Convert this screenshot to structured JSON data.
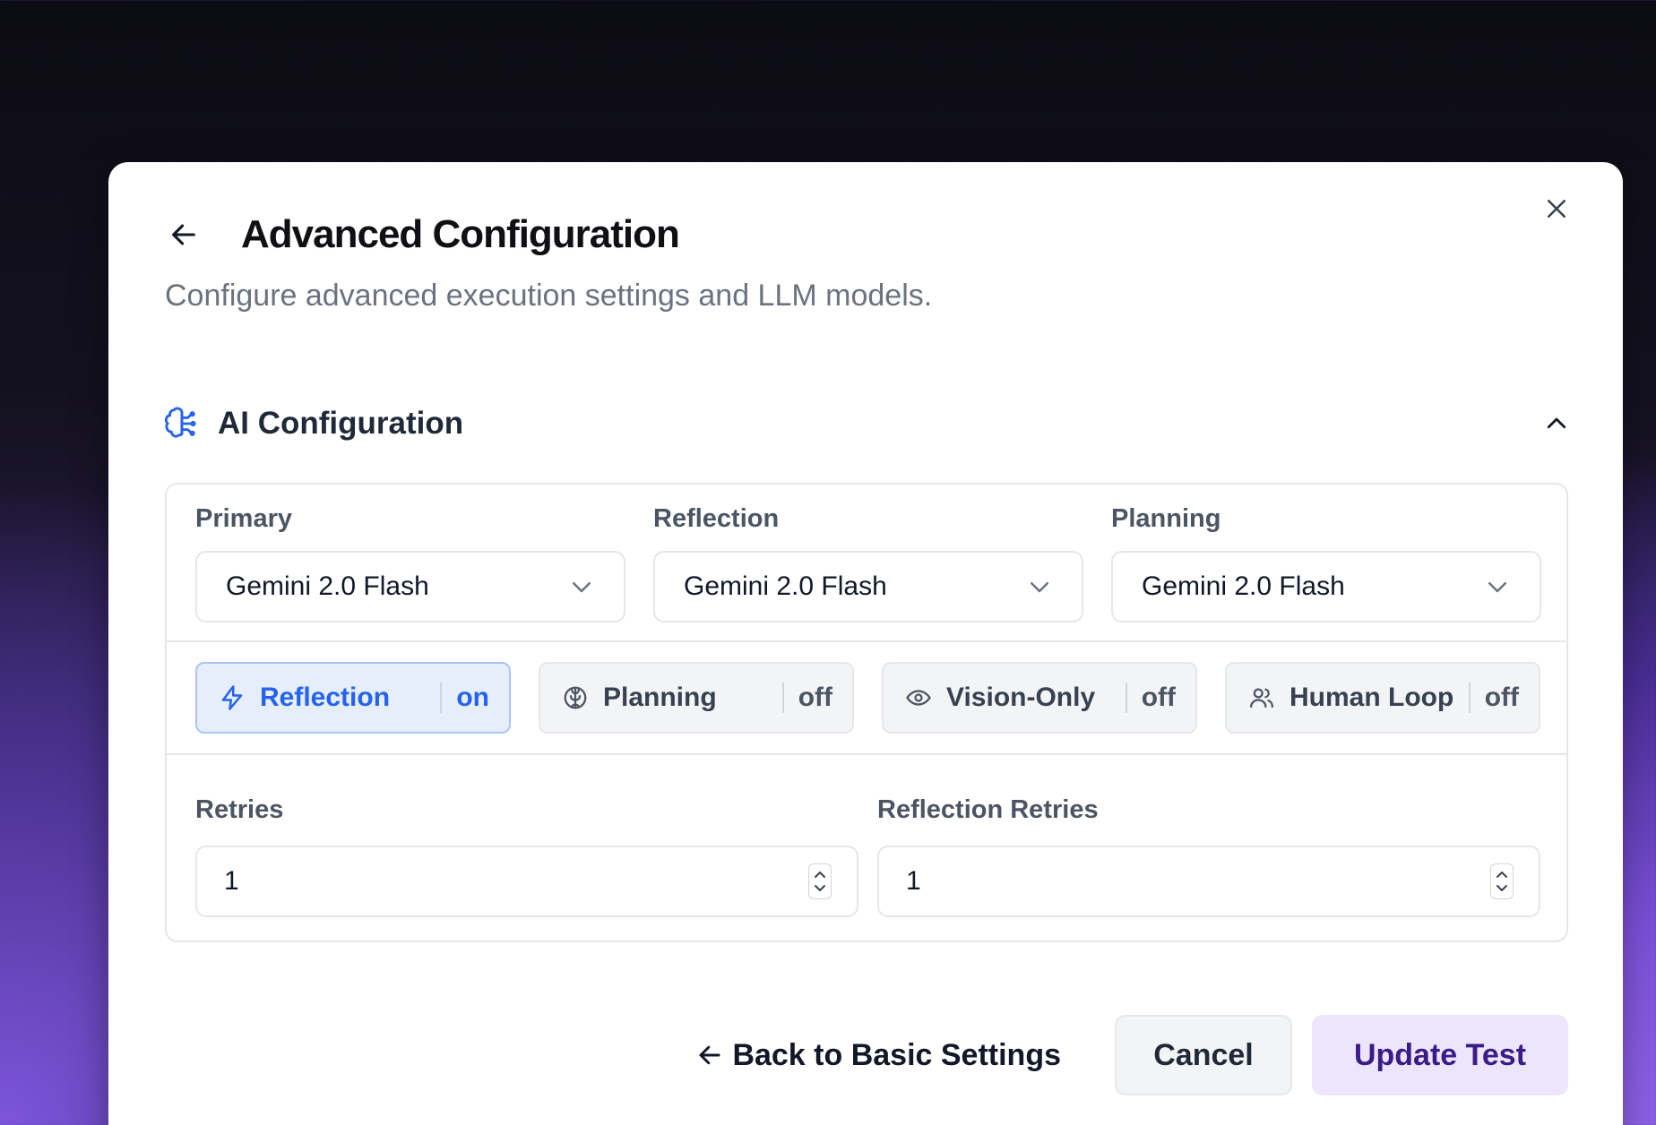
{
  "dialog": {
    "title": "Advanced Configuration",
    "subtitle": "Configure advanced execution settings and LLM models."
  },
  "section": {
    "title": "AI Configuration",
    "icon": "brain-circuit-icon",
    "expanded": true
  },
  "models": [
    {
      "label": "Primary",
      "value": "Gemini 2.0 Flash"
    },
    {
      "label": "Reflection",
      "value": "Gemini 2.0 Flash"
    },
    {
      "label": "Planning",
      "value": "Gemini 2.0 Flash"
    }
  ],
  "toggles": [
    {
      "label": "Reflection",
      "state": "on",
      "icon": "lightning-icon"
    },
    {
      "label": "Planning",
      "state": "off",
      "icon": "brain-icon"
    },
    {
      "label": "Vision-Only",
      "state": "off",
      "icon": "eye-icon"
    },
    {
      "label": "Human Loop",
      "state": "off",
      "icon": "users-icon"
    }
  ],
  "retries": [
    {
      "label": "Retries",
      "value": "1"
    },
    {
      "label": "Reflection Retries",
      "value": "1"
    }
  ],
  "footer": {
    "back_label": "Back to Basic Settings",
    "cancel_label": "Cancel",
    "update_label": "Update Test"
  },
  "colors": {
    "accent": "#2563eb",
    "primary_button_bg": "#ece6fd",
    "primary_button_text": "#3b1c87"
  }
}
